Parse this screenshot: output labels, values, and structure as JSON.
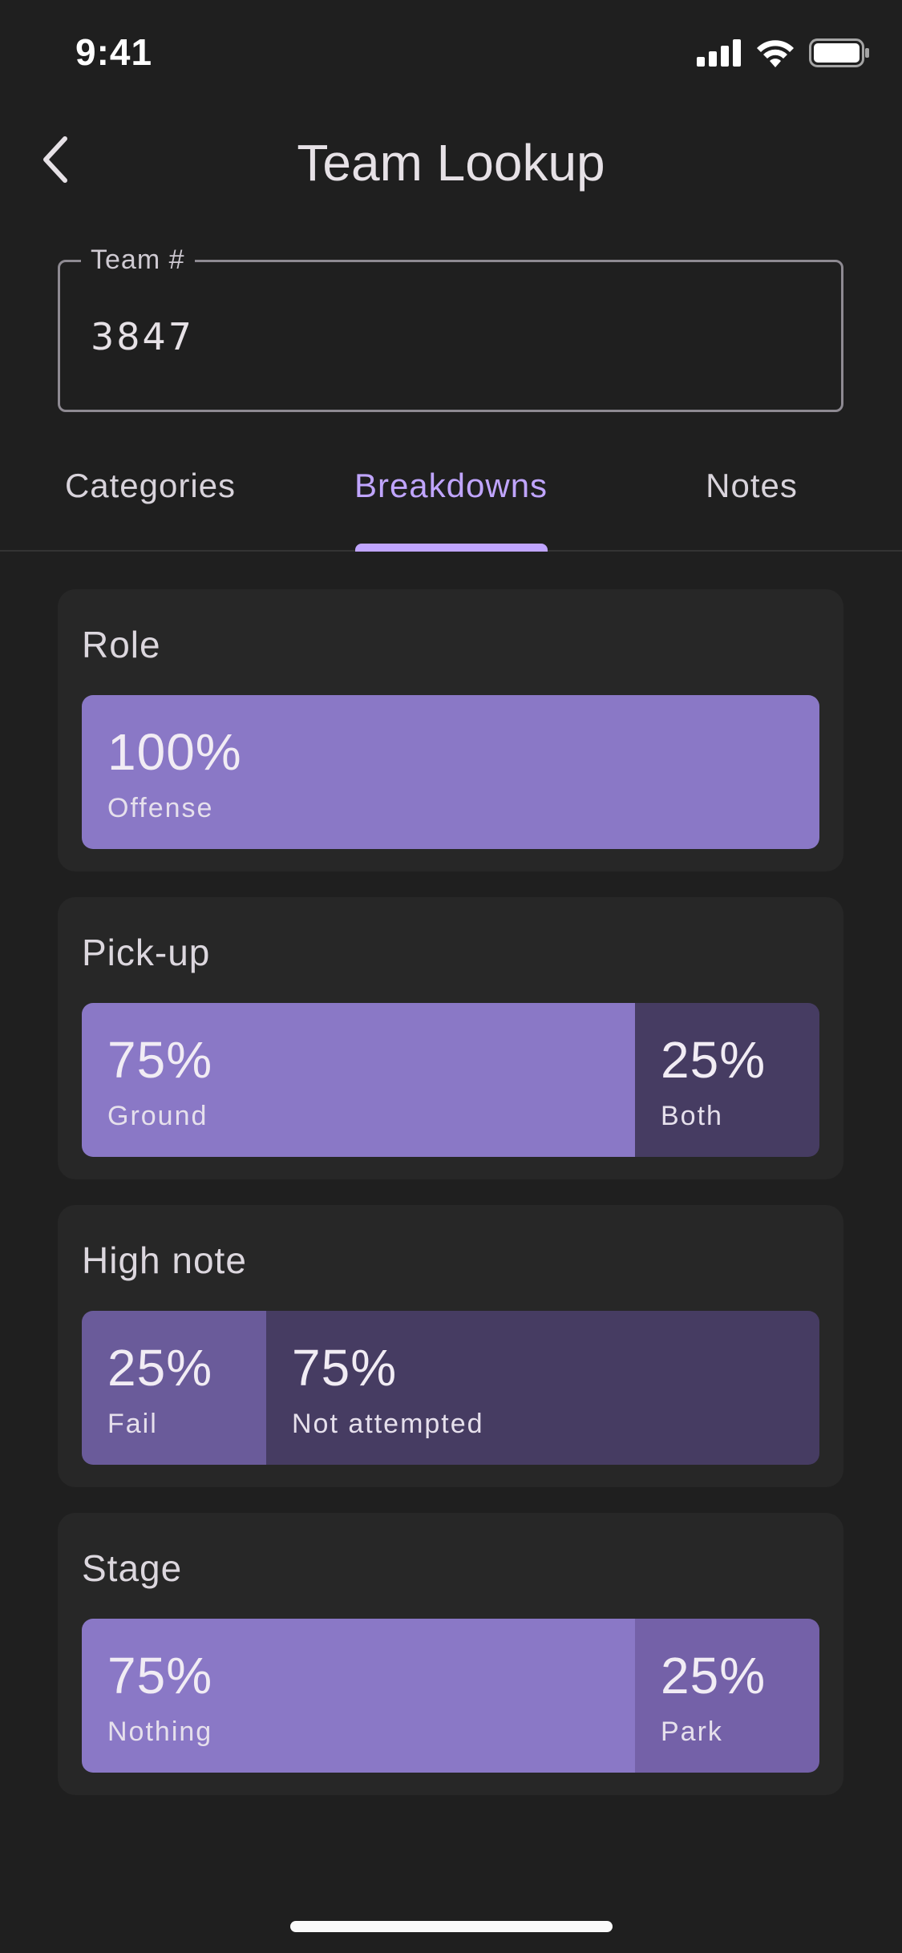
{
  "status_bar": {
    "time": "9:41",
    "icons": [
      "signal-icon",
      "wifi-icon",
      "battery-icon"
    ]
  },
  "header": {
    "title": "Team Lookup",
    "back_icon": "chevron-left-icon"
  },
  "team_field": {
    "label": "Team #",
    "value": "3847"
  },
  "tabs": [
    {
      "label": "Categories",
      "active": false
    },
    {
      "label": "Breakdowns",
      "active": true
    },
    {
      "label": "Notes",
      "active": false
    }
  ],
  "colors": {
    "background": "#1f1f1f",
    "card": "#272727",
    "accent": "#c0a5ff",
    "segment_primary": "#8a78c6",
    "segment_dark": "#463c62",
    "segment_mid": "#6a5b9a",
    "segment_light": "#7461a8"
  },
  "breakdowns": [
    {
      "title": "Role",
      "segments": [
        {
          "pct": "100%",
          "label": "Offense",
          "fraction": 1.0,
          "color": "#8a78c6"
        }
      ]
    },
    {
      "title": "Pick-up",
      "segments": [
        {
          "pct": "75%",
          "label": "Ground",
          "fraction": 0.75,
          "color": "#8a78c6"
        },
        {
          "pct": "25%",
          "label": "Both",
          "fraction": 0.25,
          "color": "#463c62"
        }
      ]
    },
    {
      "title": "High note",
      "segments": [
        {
          "pct": "25%",
          "label": "Fail",
          "fraction": 0.25,
          "color": "#6a5b9a"
        },
        {
          "pct": "75%",
          "label": "Not attempted",
          "fraction": 0.75,
          "color": "#463c62"
        }
      ]
    },
    {
      "title": "Stage",
      "segments": [
        {
          "pct": "75%",
          "label": "Nothing",
          "fraction": 0.75,
          "color": "#8a78c6"
        },
        {
          "pct": "25%",
          "label": "Park",
          "fraction": 0.25,
          "color": "#7461a8"
        }
      ]
    }
  ]
}
